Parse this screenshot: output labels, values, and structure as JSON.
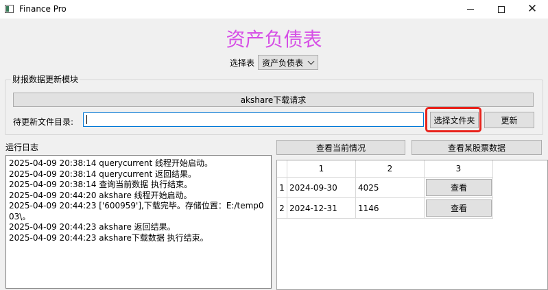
{
  "window": {
    "title": "Finance Pro"
  },
  "header": {
    "title": "资产负债表",
    "select_label": "选择表",
    "select_value": "资产负债表"
  },
  "update_module": {
    "group_title": "财报数据更新模块",
    "akshare_button": "akshare下载请求",
    "dir_label": "待更新文件目录:",
    "dir_value": "",
    "choose_folder_button": "选择文件夹",
    "update_button": "更新"
  },
  "log": {
    "label": "运行日志",
    "lines": [
      "2025-04-09 20:38:14 querycurrent 线程开始启动。",
      "2025-04-09 20:38:14 querycurrent 返回结果。",
      "2025-04-09 20:38:14 查询当前数据 执行结束。",
      "2025-04-09 20:44:20 akshare 线程开始启动。",
      "2025-04-09 20:44:23 ['600959'],下载完毕。存储位置：E:/temp003\\。",
      "2025-04-09 20:44:23 akshare 返回结果。",
      "2025-04-09 20:44:23 akshare下载数据 执行结束。"
    ]
  },
  "actions": {
    "view_current": "查看当前情况",
    "view_stock": "查看某股票数据"
  },
  "table": {
    "columns": [
      "1",
      "2",
      "3"
    ],
    "rows": [
      {
        "index": "1",
        "date": "2024-09-30",
        "value": "4025",
        "action": "查看"
      },
      {
        "index": "2",
        "date": "2024-12-31",
        "value": "1146",
        "action": "查看"
      }
    ]
  },
  "colors": {
    "title": "#d64fe6",
    "highlight": "#e8221b",
    "input_focus": "#0078d7"
  }
}
